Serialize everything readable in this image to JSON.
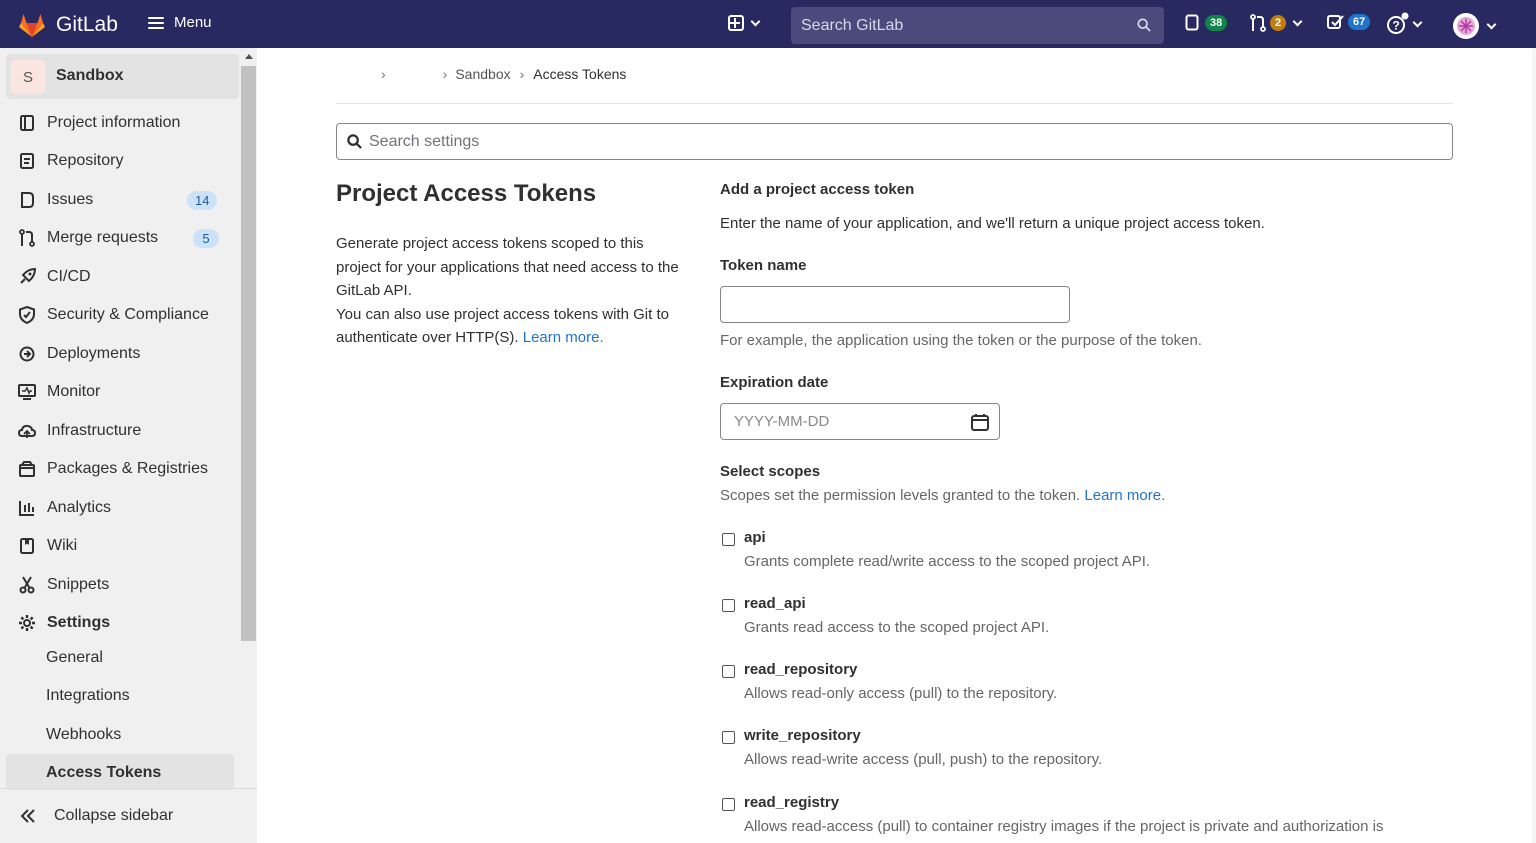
{
  "topbar": {
    "brand": "GitLab",
    "menu_label": "Menu",
    "search_placeholder": "Search GitLab",
    "issues_count": "38",
    "mr_count": "2",
    "todos_count": "67"
  },
  "sidebar": {
    "project_initial": "S",
    "project_name": "Sandbox",
    "items": [
      {
        "label": "Project information",
        "icon": "project-info-icon"
      },
      {
        "label": "Repository",
        "icon": "repository-icon"
      },
      {
        "label": "Issues",
        "icon": "issues-icon",
        "count": "14"
      },
      {
        "label": "Merge requests",
        "icon": "merge-request-icon",
        "count": "5"
      },
      {
        "label": "CI/CD",
        "icon": "rocket-icon"
      },
      {
        "label": "Security & Compliance",
        "icon": "shield-icon"
      },
      {
        "label": "Deployments",
        "icon": "deployments-icon"
      },
      {
        "label": "Monitor",
        "icon": "monitor-icon"
      },
      {
        "label": "Infrastructure",
        "icon": "cloud-icon"
      },
      {
        "label": "Packages & Registries",
        "icon": "package-icon"
      },
      {
        "label": "Analytics",
        "icon": "chart-icon"
      },
      {
        "label": "Wiki",
        "icon": "book-icon"
      },
      {
        "label": "Snippets",
        "icon": "scissors-icon"
      },
      {
        "label": "Settings",
        "icon": "gear-icon"
      }
    ],
    "settings_sub": [
      "General",
      "Integrations",
      "Webhooks",
      "Access Tokens"
    ],
    "collapse_label": "Collapse sidebar"
  },
  "breadcrumb": {
    "items": [
      "Sandbox",
      "Access Tokens"
    ]
  },
  "settings_search_placeholder": "Search settings",
  "left": {
    "title": "Project Access Tokens",
    "desc1": "Generate project access tokens scoped to this project for your applications that need access to the GitLab API.",
    "desc2": "You can also use project access tokens with Git to authenticate over HTTP(S).",
    "learn_more": "Learn more."
  },
  "form": {
    "heading": "Add a project access token",
    "intro": "Enter the name of your application, and we'll return a unique project access token.",
    "token_name_label": "Token name",
    "token_name_value": "",
    "token_name_help": "For example, the application using the token or the purpose of the token.",
    "expiration_label": "Expiration date",
    "expiration_placeholder": "YYYY-MM-DD",
    "scopes_label": "Select scopes",
    "scopes_help": "Scopes set the permission levels granted to the token.",
    "scopes_learn_more": "Learn more.",
    "scopes": [
      {
        "name": "api",
        "desc": "Grants complete read/write access to the scoped project API."
      },
      {
        "name": "read_api",
        "desc": "Grants read access to the scoped project API."
      },
      {
        "name": "read_repository",
        "desc": "Allows read-only access (pull) to the repository."
      },
      {
        "name": "write_repository",
        "desc": "Allows read-write access (pull, push) to the repository."
      },
      {
        "name": "read_registry",
        "desc": "Allows read-access (pull) to container registry images if the project is private and authorization is"
      }
    ]
  },
  "colors": {
    "topbar": "#292961",
    "link": "#1f75cb",
    "issues_badge": "#108548",
    "mr_badge": "#c17d10",
    "todo_badge": "#1f75cb"
  }
}
